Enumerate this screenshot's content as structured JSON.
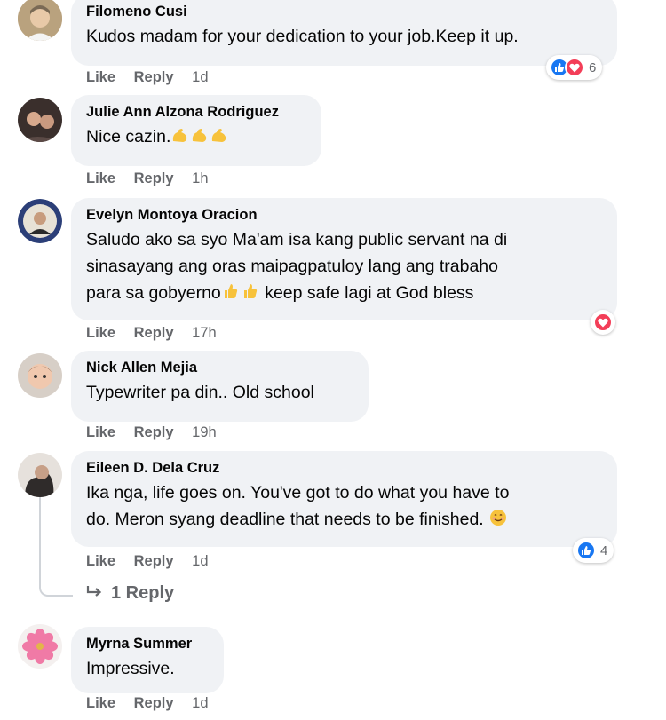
{
  "actions": {
    "like": "Like",
    "reply": "Reply"
  },
  "colors": {
    "bubble": "#f0f2f5",
    "like_blue": "#1877f2",
    "love_red": "#f33e58",
    "muted": "#65676b"
  },
  "comments": [
    {
      "author": "Filomeno Cusi",
      "lines": [
        "Kudos madam for your dedication to your job.Keep it up."
      ],
      "time": "1d",
      "reactions": {
        "icons": [
          "like-icon",
          "love-icon"
        ],
        "count": "6"
      }
    },
    {
      "author": "Julie Ann Alzona Rodriguez",
      "lines": [
        "Nice cazin."
      ],
      "emojis": [
        "flexed-biceps",
        "flexed-biceps",
        "flexed-biceps"
      ],
      "time": "1h"
    },
    {
      "author": "Evelyn Montoya Oracion",
      "lines": [
        "Saludo ako sa syo Ma'am isa kang public servant na di",
        "sinasayang ang oras maipagpatuloy lang ang trabaho",
        "para sa gobyerno",
        "keep safe lagi at God bless"
      ],
      "time": "17h",
      "reactions": {
        "icons": [
          "love-icon"
        ],
        "count": ""
      }
    },
    {
      "author": "Nick Allen Mejia",
      "lines": [
        "Typewriter pa din.. Old school"
      ],
      "time": "19h"
    },
    {
      "author": "Eileen D. Dela Cruz",
      "lines": [
        "Ika nga, life goes on. You've got to do what you have to",
        "do. Meron syang deadline that needs to be finished."
      ],
      "time": "1d",
      "reactions": {
        "icons": [
          "like-icon"
        ],
        "count": "4"
      },
      "replies_label": "1 Reply"
    },
    {
      "author": "Myrna Summer",
      "lines": [
        "Impressive."
      ],
      "time": "1d"
    }
  ]
}
